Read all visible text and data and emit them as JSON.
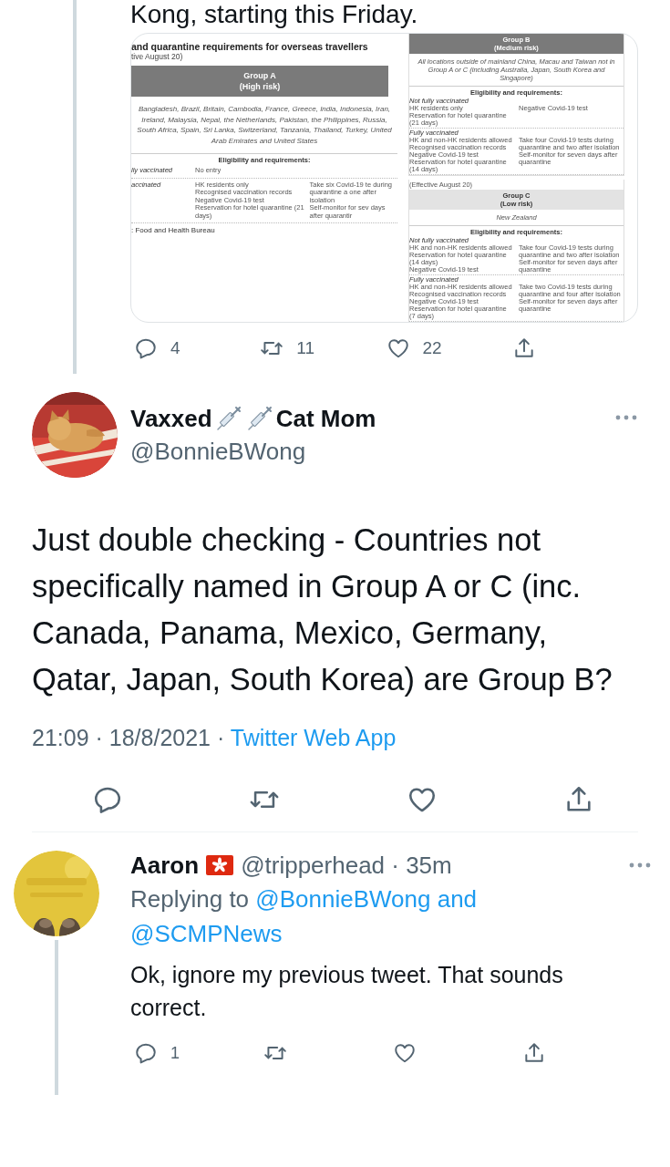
{
  "previous_tweet": {
    "text": "Kong, starting this Friday.",
    "document": {
      "left": {
        "title": "and quarantine requirements for overseas travellers",
        "subtitle": "tive August 20)",
        "group": "Group A",
        "risk": "(High risk)",
        "countries": "Bangladesh, Brazil, Britain, Cambodia, France, Greece, India, Indonesia, Iran, Ireland, Malaysia, Nepal, the Netherlands, Pakistan, the Philippines, Russia, South Africa, Spain, Sri Lanka, Switzerland, Tanzania, Thailand, Turkey, United Arab Emirates and United States",
        "requirements_heading": "Eligibility and requirements:",
        "rows": [
          {
            "label": "lly vaccinated",
            "col_1": [
              "No entry"
            ],
            "col_2": []
          },
          {
            "label": "accinated",
            "col_1": [
              "HK residents only",
              "Recognised vaccination records",
              "Negative Covid-19 test",
              "Reservation for hotel quarantine (21 days)"
            ],
            "col_2": [
              "Take six Covid-19 te during quarantine a one after isolation",
              "Self-monitor for sev days after quarantir"
            ]
          }
        ],
        "source": ": Food and Health Bureau"
      },
      "right": [
        {
          "kind": "dark",
          "group": "Group B",
          "risk": "(Medium risk)",
          "countries": "All locations outside of mainland China, Macau and Taiwan not in Group A or C (including Australia, Japan, South Korea and Singapore)",
          "requirements_heading": "Eligibility and requirements:",
          "rows": [
            {
              "label": "Not fully vaccinated",
              "col_1": [
                "HK residents only",
                "Reservation for hotel quarantine (21 days)"
              ],
              "col_2": [
                "Negative Covid-19 test"
              ]
            },
            {
              "label": "Fully vaccinated",
              "col_1": [
                "HK and non-HK residents allowed",
                "Recognised vaccination records",
                "Negative Covid-19 test",
                "Reservation for hotel quarantine (14 days)"
              ],
              "col_2": [
                "Take four Covid-19 tests during quarantine and two after isolation",
                "Self-monitor for seven days after quarantine"
              ]
            }
          ]
        },
        {
          "kind": "light",
          "effective": "(Effective August 20)",
          "group": "Group C",
          "risk": "(Low risk)",
          "countries": "New Zealand",
          "requirements_heading": "Eligibility and requirements:",
          "rows": [
            {
              "label": "Not fully vaccinated",
              "col_1": [
                "HK and non-HK residents allowed",
                "Reservation for hotel quarantine (14 days)",
                "Negative Covid-19 test"
              ],
              "col_2": [
                "Take four Covid-19 tests during quarantine and two after isolation",
                "Self-monitor for seven days after quarantine"
              ]
            },
            {
              "label": "Fully vaccinated",
              "col_1": [
                "HK and non-HK residents allowed",
                "Recognised vaccination records",
                "Negative Covid-19 test",
                "Reservation for hotel quarantine (7 days)"
              ],
              "col_2": [
                "Take two Covid-19 tests during quarantine and four after isolation",
                "Self-monitor for seven days after quarantine"
              ]
            }
          ]
        }
      ]
    },
    "replies": "4",
    "retweets": "11",
    "likes": "22"
  },
  "main_tweet": {
    "name_parts": [
      "Vaxxed",
      "Cat Mom"
    ],
    "handle": "@BonnieBWong",
    "text": "Just double checking - Countries not specifically named in Group A or C (inc. Canada, Panama, Mexico, Germany, Qatar, Japan, South Korea) are Group B?",
    "time": "21:09 · 18/8/2021 · ",
    "source": "Twitter Web App"
  },
  "reply": {
    "name": "Aaron",
    "handle": "@tripperhead · 35m",
    "replying_prefix": "Replying to ",
    "replying_to": [
      "@BonnieBWong",
      "@SCMPNews"
    ],
    "replying_joiner": " and ",
    "text": "Ok, ignore my previous tweet. That sounds correct.",
    "replies": "1"
  }
}
